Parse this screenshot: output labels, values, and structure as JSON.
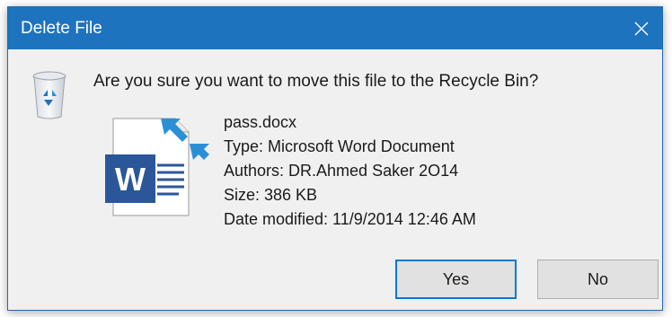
{
  "dialog": {
    "title": "Delete File",
    "message": "Are you sure you want to move this file to the Recycle Bin?"
  },
  "file": {
    "name": "pass.docx",
    "type": "Type: Microsoft Word Document",
    "authors": "Authors: DR.Ahmed Saker 2O14",
    "size": "Size: 386 KB",
    "date_modified": "Date modified: 11/9/2014 12:46 AM"
  },
  "buttons": {
    "yes": "Yes",
    "no": "No"
  },
  "icons": {
    "close": "close-icon",
    "recycle_bin": "recycle-bin-icon",
    "file": "word-document-icon",
    "shortcut_arrow": "shortcut-arrow-icon"
  },
  "colors": {
    "titlebar": "#1e73be",
    "word_blue": "#2b579a",
    "accent": "#0078d7"
  }
}
